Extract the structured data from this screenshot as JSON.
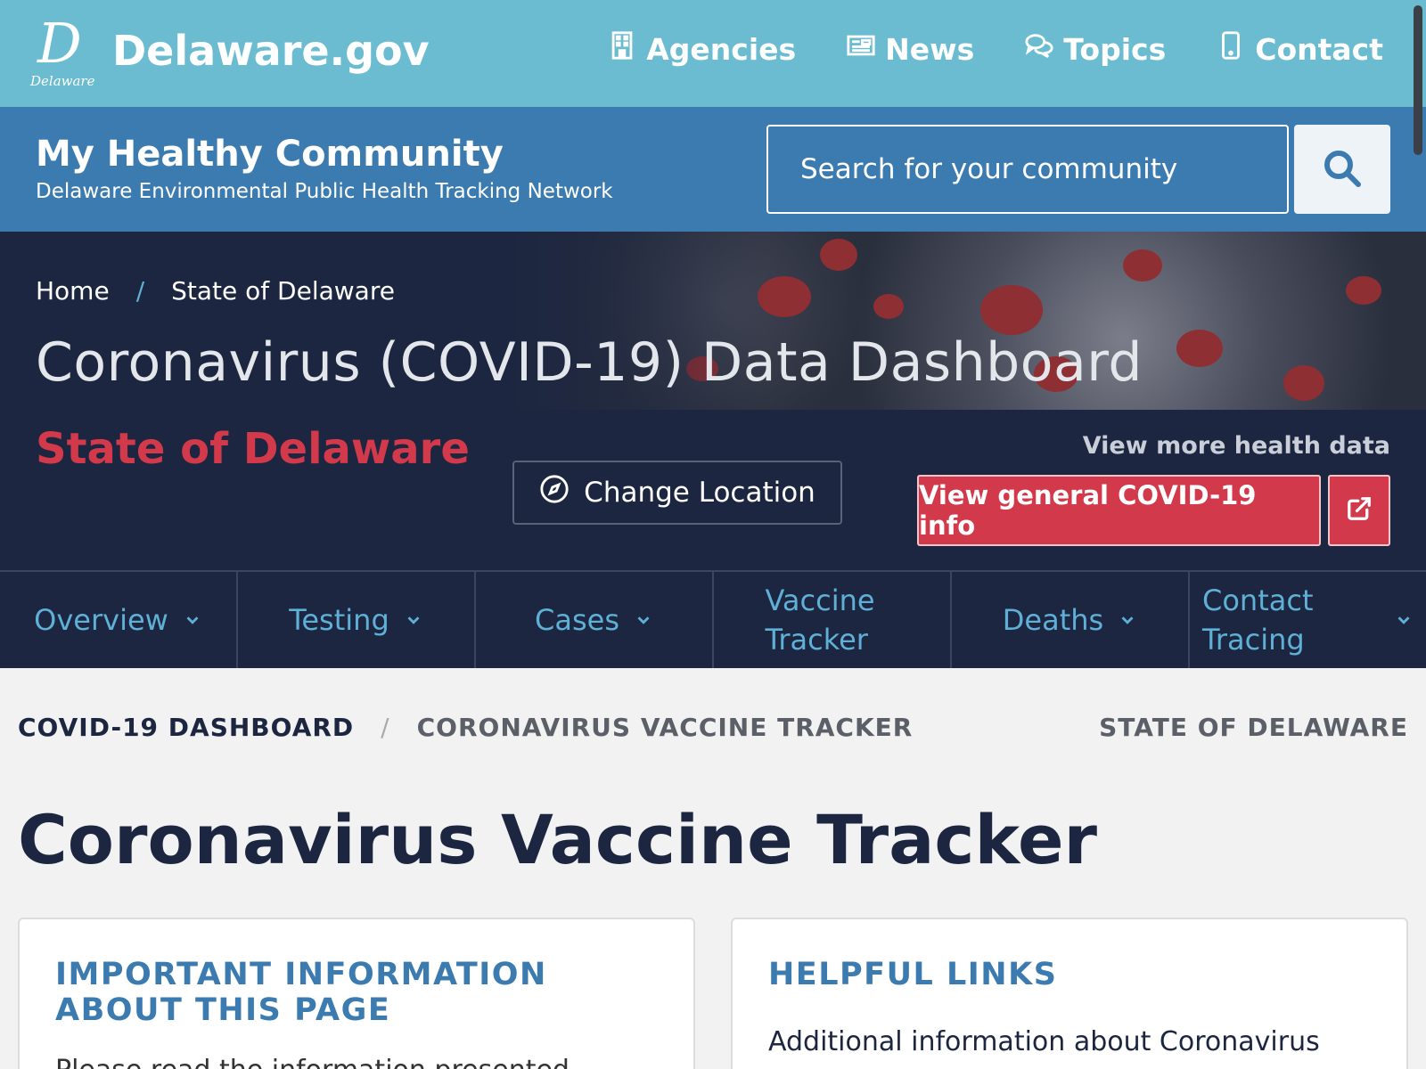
{
  "gov_bar": {
    "logo_letter": "D",
    "logo_word": "Delaware",
    "title": "Delaware.gov",
    "nav": [
      {
        "label": "Agencies",
        "icon": "building-icon"
      },
      {
        "label": "News",
        "icon": "newspaper-icon"
      },
      {
        "label": "Topics",
        "icon": "chat-bubbles-icon"
      },
      {
        "label": "Contact",
        "icon": "mobile-phone-icon"
      }
    ]
  },
  "site_header": {
    "title": "My Healthy Community",
    "subtitle": "Delaware Environmental Public Health Tracking Network",
    "search_placeholder": "Search for your community",
    "search_icon": "search-icon"
  },
  "hero": {
    "breadcrumb": {
      "home": "Home",
      "separator": "/",
      "current": "State of Delaware"
    },
    "title": "Coronavirus (COVID-19) Data Dashboard",
    "location": "State of Delaware",
    "change_location_label": "Change Location",
    "more_health_label": "View more health data",
    "covid_info_label": "View general COVID-19 info"
  },
  "tabs": [
    {
      "label": "Overview",
      "has_chevron": true
    },
    {
      "label": "Testing",
      "has_chevron": true
    },
    {
      "label": "Cases",
      "has_chevron": true
    },
    {
      "label": "Vaccine Tracker",
      "has_chevron": false
    },
    {
      "label": "Deaths",
      "has_chevron": true
    },
    {
      "label": "Contact Tracing",
      "has_chevron": true
    }
  ],
  "content": {
    "breadcrumb": {
      "dashboard": "COVID-19 DASHBOARD",
      "separator": "/",
      "current": "CORONAVIRUS VACCINE TRACKER"
    },
    "location": "STATE OF DELAWARE",
    "title": "Coronavirus Vaccine Tracker",
    "cards": {
      "important": {
        "title": "IMPORTANT INFORMATION ABOUT THIS PAGE",
        "text": "Please read the information presented"
      },
      "helpful": {
        "title": "HELPFUL LINKS",
        "text": "Additional information about Coronavirus"
      }
    }
  },
  "colors": {
    "gov_bar": "#6bbcd0",
    "site_header": "#3b7bb0",
    "hero_bg": "#1c2640",
    "accent_red": "#d2394a",
    "tab_text": "#5fb0d6"
  }
}
